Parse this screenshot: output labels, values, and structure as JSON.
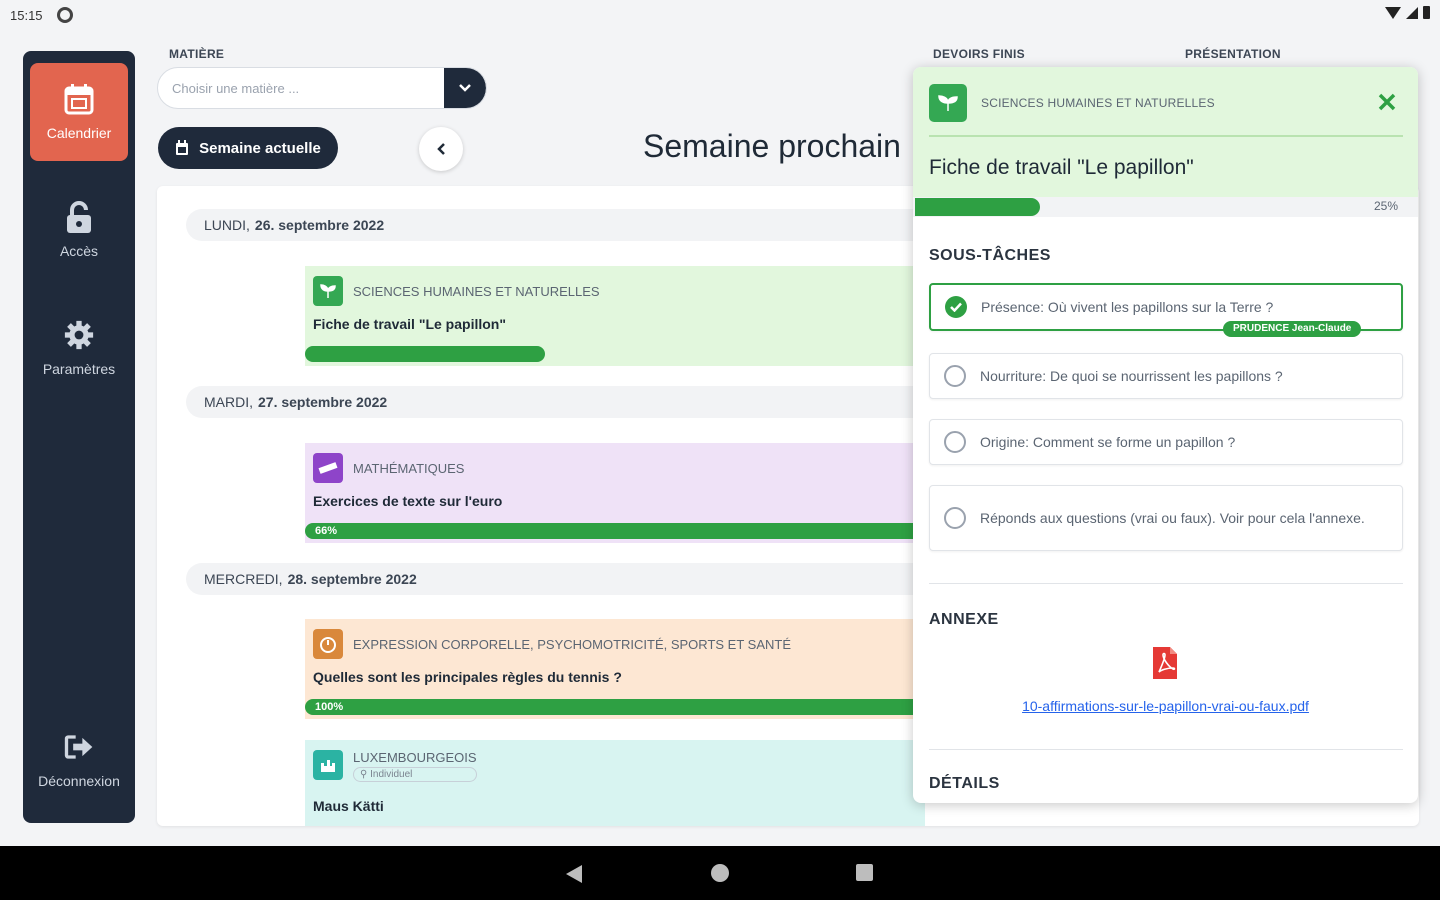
{
  "status": {
    "time": "15:15"
  },
  "sidebar": {
    "items": [
      {
        "label": "Calendrier",
        "icon": "calendar-icon",
        "active": true
      },
      {
        "label": "Accès",
        "icon": "lock-icon"
      },
      {
        "label": "Paramètres",
        "icon": "gear-icon"
      },
      {
        "label": "Déconnexion",
        "icon": "logout-icon"
      }
    ]
  },
  "filters": {
    "subject_label": "MATIÈRE",
    "subject_placeholder": "Choisir une matière ...",
    "done_label": "DEVOIRS FINIS",
    "presentation_label": "PRÉSENTATION"
  },
  "toolbar": {
    "current_week": "Semaine actuelle",
    "week_title": "Semaine prochain"
  },
  "days": [
    {
      "prefix": "LUNDI,",
      "date": "26. septembre 2022",
      "tasks": [
        {
          "subject": "SCIENCES HUMAINES ET NATURELLES",
          "title": "Fiche de travail \"Le papillon\"",
          "progress": 25,
          "progress_label": "",
          "color": "#e2f7dd",
          "icon_color": "#34a853"
        }
      ]
    },
    {
      "prefix": "MARDI,",
      "date": "27. septembre 2022",
      "tasks": [
        {
          "subject": "MATHÉMATIQUES",
          "title": "Exercices de texte sur l'euro",
          "progress": 66,
          "progress_label": "66%",
          "color": "#efe2f7",
          "icon_color": "#8e44c9"
        }
      ]
    },
    {
      "prefix": "MERCREDI,",
      "date": "28. septembre 2022",
      "tasks": [
        {
          "subject": "EXPRESSION CORPORELLE, PSYCHOMOTRICITÉ, SPORTS ET SANTÉ",
          "title": "Quelles sont les principales règles du tennis ?",
          "progress": 100,
          "progress_label": "100%",
          "color": "#fde7d3",
          "icon_color": "#d9883b"
        },
        {
          "subject": "LUXEMBOURGEOIS",
          "badge": "Individuel",
          "title": "Maus Kätti",
          "color": "#d8f4f1",
          "icon_color": "#2bb3a3"
        }
      ]
    }
  ],
  "panel": {
    "subject": "SCIENCES HUMAINES ET NATURELLES",
    "title": "Fiche de travail \"Le papillon\"",
    "progress": 25,
    "progress_label": "25%",
    "subtasks_heading": "SOUS-TÂCHES",
    "subtasks": [
      {
        "text": "Présence: Où vivent les papillons sur la Terre ?",
        "done": true,
        "by": "PRUDENCE Jean-Claude"
      },
      {
        "text": "Nourriture: De quoi se nourrissent les papillons ?",
        "done": false
      },
      {
        "text": "Origine: Comment se forme un papillon ?",
        "done": false
      },
      {
        "text": "Réponds aux questions (vrai ou faux). Voir pour cela l'annexe.",
        "done": false
      }
    ],
    "annex_heading": "ANNEXE",
    "annex_file": "10-affirmations-sur-le-papillon-vrai-ou-faux.pdf",
    "details_heading": "DÉTAILS"
  }
}
